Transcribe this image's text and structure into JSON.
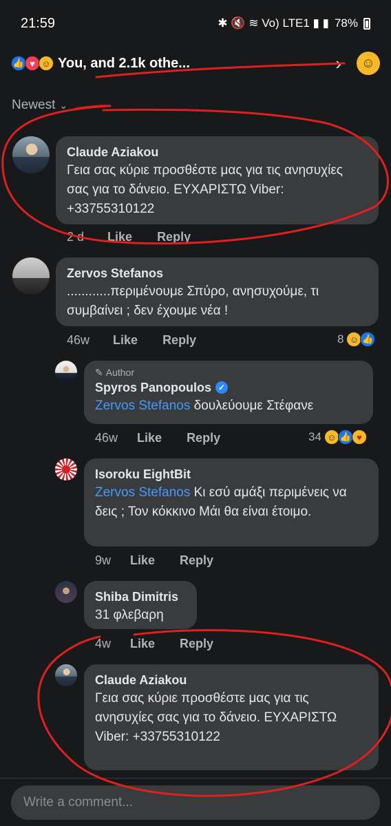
{
  "status_bar": {
    "time": "21:59",
    "icons_text": "✱ 🔇 ≋ Vo) LTE1 ▮ ▮",
    "battery": "78%"
  },
  "reactions_bar": {
    "text": "You,                   and 2.1k othe...",
    "reaction_icons": [
      "like-icon",
      "love-icon",
      "haha-icon"
    ]
  },
  "sort": {
    "label": "Newest"
  },
  "comments": [
    {
      "name": "Claude Aziakou",
      "text": "Γεια σας κύριε προσθέστε μας για τις ανησυχίες σας για το δάνειο. ΕΥΧΑΡΙΣΤΩ Viber: +33755310122",
      "time": "2 d",
      "like": "Like",
      "reply": "Reply"
    },
    {
      "name": "Zervos Stefanos",
      "text": "............περιμένουμε Σπύρο, ανησυχούμε, τι συμβαίνει ;  δεν έχουμε νέα !",
      "time": "46w",
      "like": "Like",
      "reply": "Reply",
      "reactions": "8"
    }
  ],
  "replies": [
    {
      "author_tag": "Author",
      "name": "Spyros Panopoulos",
      "mention": "Zervos Stefanos",
      "text": " δουλεύουμε Στέφανε",
      "time": "46w",
      "like": "Like",
      "reply": "Reply",
      "reactions": "34"
    },
    {
      "name": "Isoroku EightBit",
      "mention": "Zervos Stefanos",
      "text": " Κι εσύ αμάξι περιμένεις να δεις ; Τον κόκκινο Μάι θα είναι έτοιμο.",
      "time": "9w",
      "like": "Like",
      "reply": "Reply"
    },
    {
      "name": "Shiba Dimitris",
      "text": "31 φλεβαρη",
      "time": "4w",
      "like": "Like",
      "reply": "Reply"
    },
    {
      "name": "Claude Aziakou",
      "text": "Γεια σας κύριε προσθέστε μας για τις ανησυχίες σας για το δάνειο. ΕΥΧΑΡΙΣΤΩ Viber: +33755310122"
    }
  ],
  "composer": {
    "placeholder": "Write a comment..."
  },
  "colors": {
    "background": "#18191a",
    "bubble": "#3a3b3c",
    "mention": "#4599ff",
    "annotation": "#e0201f"
  }
}
